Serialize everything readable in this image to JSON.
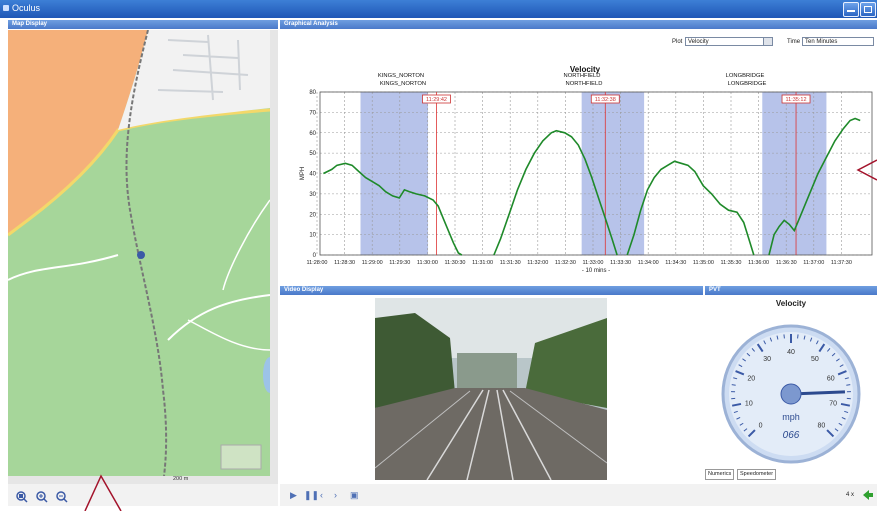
{
  "window": {
    "title": "Oculus"
  },
  "panels": {
    "map": "Map Display",
    "graph": "Graphical Analysis",
    "video": "Video Display",
    "pvt": "PVT"
  },
  "graph_controls": {
    "plot_label": "Plot",
    "plot_value": "Velocity",
    "time_label": "Time",
    "time_value": "Ten Minutes"
  },
  "stations": [
    {
      "name": "KINGS_NORTON",
      "sub": "KINGS_NORTON",
      "time": "11:29:42"
    },
    {
      "name": "NORTHFIELD",
      "sub": "NORTHFIELD",
      "time": "11:32:38"
    },
    {
      "name": "LONGBRIDGE",
      "sub": "LONGBRIDGE",
      "time": "11:35:12"
    }
  ],
  "chart_data": {
    "type": "line",
    "title": "Velocity",
    "ylabel": "MPH",
    "xlabel": "- 10 mins -",
    "ylim": [
      0,
      80
    ],
    "yticks": [
      "0",
      "10",
      "20",
      "30",
      "40",
      "50",
      "60",
      "70",
      "80"
    ],
    "xticks": [
      "11:28:00",
      "11:28:30",
      "11:29:00",
      "11:29:30",
      "11:30:00",
      "11:30:30",
      "11:31:00",
      "11:31:30",
      "11:32:00",
      "11:32:30",
      "11:33:00",
      "11:33:30",
      "11:34:00",
      "11:34:30",
      "11:35:00",
      "11:35:30",
      "11:36:00",
      "11:36:30",
      "11:37:00",
      "11:37:30"
    ],
    "grid": true,
    "series": [
      {
        "color": "#1f8a2a",
        "segments": [
          [
            [
              -0.5,
              40
            ],
            [
              0,
              42
            ],
            [
              0.3,
              44
            ],
            [
              0.8,
              45
            ],
            [
              1.2,
              44
            ],
            [
              1.6,
              41
            ],
            [
              2,
              38
            ],
            [
              2.4,
              36
            ],
            [
              2.8,
              34
            ],
            [
              3.2,
              31
            ],
            [
              3.6,
              29
            ],
            [
              4,
              28
            ],
            [
              4.3,
              32
            ],
            [
              4.6,
              31
            ],
            [
              5,
              30
            ],
            [
              5.5,
              29
            ],
            [
              6,
              27
            ],
            [
              6.3,
              24
            ],
            [
              6.6,
              18
            ],
            [
              6.9,
              12
            ],
            [
              7.2,
              6
            ],
            [
              7.5,
              1
            ],
            [
              7.7,
              0
            ]
          ],
          [
            [
              9.6,
              0
            ],
            [
              10,
              8
            ],
            [
              10.5,
              20
            ],
            [
              11,
              32
            ],
            [
              11.5,
              42
            ],
            [
              12,
              50
            ],
            [
              12.5,
              56
            ],
            [
              13,
              60
            ],
            [
              13.3,
              61
            ],
            [
              13.8,
              60
            ],
            [
              14.2,
              58
            ],
            [
              14.6,
              54
            ],
            [
              15,
              47
            ],
            [
              15.4,
              38
            ],
            [
              15.8,
              28
            ],
            [
              16.2,
              18
            ],
            [
              16.6,
              8
            ],
            [
              16.9,
              0
            ]
          ],
          [
            [
              17.5,
              0
            ],
            [
              17.9,
              10
            ],
            [
              18.3,
              22
            ],
            [
              18.7,
              32
            ],
            [
              19.1,
              38
            ],
            [
              19.5,
              42
            ],
            [
              19.9,
              44
            ],
            [
              20.3,
              46
            ],
            [
              20.7,
              45
            ],
            [
              21.1,
              44
            ],
            [
              21.5,
              41
            ],
            [
              22,
              34
            ],
            [
              22.5,
              30
            ],
            [
              23,
              25
            ],
            [
              23.5,
              22
            ],
            [
              24,
              21
            ],
            [
              24.4,
              16
            ],
            [
              24.7,
              8
            ],
            [
              25,
              0
            ]
          ],
          [
            [
              25.9,
              0
            ],
            [
              26.2,
              10
            ],
            [
              26.5,
              14
            ],
            [
              26.8,
              17
            ],
            [
              27.1,
              15
            ],
            [
              27.4,
              12
            ],
            [
              27.8,
              20
            ],
            [
              28.3,
              30
            ],
            [
              28.8,
              40
            ],
            [
              29.3,
              48
            ],
            [
              29.8,
              56
            ],
            [
              30.3,
              62
            ],
            [
              30.7,
              66
            ],
            [
              31,
              67
            ],
            [
              31.3,
              66
            ]
          ]
        ]
      }
    ]
  },
  "pvt": {
    "title": "Velocity",
    "unit": "mph",
    "digital": "066",
    "gauge_ticks": [
      "0",
      "10",
      "20",
      "30",
      "40",
      "50",
      "60",
      "70",
      "80"
    ],
    "value": 66,
    "tabs": [
      "Numerics",
      "Speedometer"
    ]
  },
  "map": {
    "scale_label": "200 m"
  },
  "playback": {
    "rate": "4 x"
  }
}
